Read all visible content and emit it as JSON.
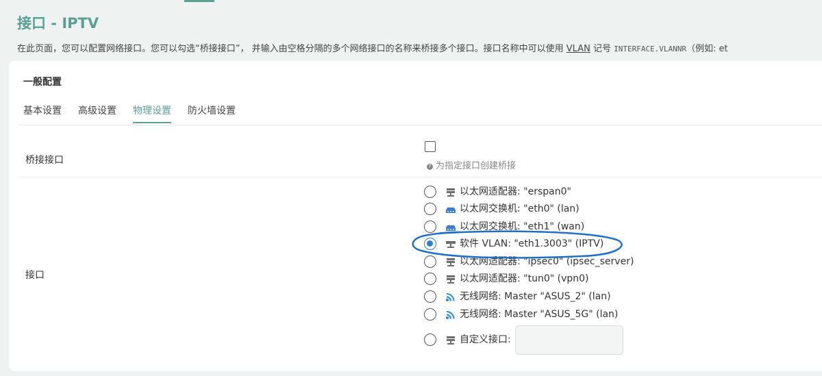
{
  "page": {
    "title": "接口 - IPTV",
    "description": {
      "pre": "在此页面，您可以配置网络接口。您可以勾选“桥接接口”， 并输入由空格分隔的多个网络接口的名称来桥接多个接口。接口名称中可以使用 ",
      "link": "VLAN",
      "mid": " 记号 ",
      "code": "INTERFACE.VLANNR",
      "post": "（例如: et"
    }
  },
  "section": {
    "title": "一般配置"
  },
  "tabs": [
    {
      "label": "基本设置",
      "active": false
    },
    {
      "label": "高级设置",
      "active": false
    },
    {
      "label": "物理设置",
      "active": true
    },
    {
      "label": "防火墙设置",
      "active": false
    }
  ],
  "bridge": {
    "label": "桥接接口",
    "checked": false,
    "hint": "为指定接口创建桥接"
  },
  "interface": {
    "label": "接口",
    "options": [
      {
        "icon": "ethernet-adapter-icon",
        "text": "以太网适配器: \"erspan0\"",
        "selected": false
      },
      {
        "icon": "ethernet-switch-icon",
        "text": "以太网交换机: \"eth0\" (lan)",
        "selected": false
      },
      {
        "icon": "ethernet-switch-icon",
        "text": "以太网交换机: \"eth1\" (wan)",
        "selected": false
      },
      {
        "icon": "software-vlan-icon",
        "text": "软件 VLAN: \"eth1.3003\" (IPTV)",
        "selected": true
      },
      {
        "icon": "ethernet-adapter-icon",
        "text": "以太网适配器: \"ipsec0\" (ipsec_server)",
        "selected": false
      },
      {
        "icon": "ethernet-adapter-icon",
        "text": "以太网适配器: \"tun0\" (vpn0)",
        "selected": false
      },
      {
        "icon": "wireless-icon",
        "text": "无线网络: Master \"ASUS_2\" (lan)",
        "selected": false
      },
      {
        "icon": "wireless-icon",
        "text": "无线网络: Master \"ASUS_5G\" (lan)",
        "selected": false
      }
    ],
    "custom": {
      "icon": "ethernet-adapter-icon",
      "label": "自定义接口:",
      "value": ""
    }
  },
  "colors": {
    "accent": "#5b9e93",
    "radio_selected": "#2d7dd2",
    "annotation": "#1f6fc6"
  }
}
